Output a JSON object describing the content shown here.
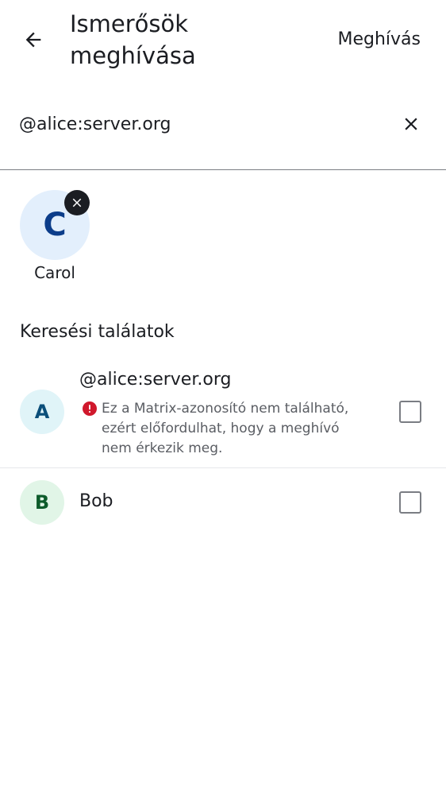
{
  "header": {
    "title": "Ismerősök meghívása",
    "invite_label": "Meghívás"
  },
  "search": {
    "value": "@alice:server.org"
  },
  "selected": [
    {
      "initial": "C",
      "name": "Carol"
    }
  ],
  "results": {
    "section_title": "Keresési találatok",
    "items": [
      {
        "initial": "A",
        "name": "@alice:server.org",
        "warning": "Ez a Matrix-azonosító nem található, ezért előfordulhat, hogy a meghívó nem érkezik meg.",
        "checked": false
      },
      {
        "initial": "B",
        "name": "Bob",
        "checked": false
      }
    ]
  },
  "icons": {
    "back": "arrow-back-icon",
    "clear": "close-icon",
    "remove": "close-icon",
    "warning": "error-icon"
  },
  "colors": {
    "warning": "#d0182c",
    "avatar_c_bg": "#e3effc",
    "avatar_a_bg": "#e0f4f8",
    "avatar_b_bg": "#e1f5e7"
  }
}
